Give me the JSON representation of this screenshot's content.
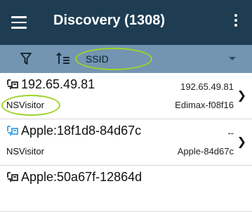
{
  "appbar": {
    "title": "Discovery (1308)"
  },
  "toolbar": {
    "sort_field": "SSID"
  },
  "devices": [
    {
      "name": "192.65.49.81",
      "ssid": "NSVisitor",
      "ip": "192.65.49.81",
      "vendor": "Edimax-f08f16",
      "icon_color": "#222222"
    },
    {
      "name": "Apple:18f1d8-84d67c",
      "ssid": "NSVisitor",
      "ip": "--",
      "vendor": "Apple-84d67c",
      "icon_color": "#3aa0e0"
    },
    {
      "name": "Apple:50a67f-12864d",
      "ssid": "",
      "ip": "",
      "vendor": "",
      "icon_color": "#222222"
    }
  ],
  "colors": {
    "appbar": "#1e3d52",
    "toolbar": "#7395b1",
    "highlight": "#9dd32a"
  }
}
